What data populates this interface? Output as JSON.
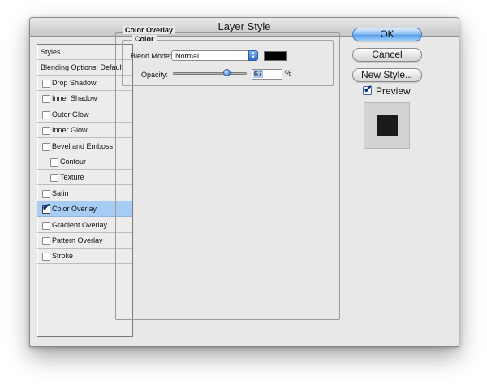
{
  "window": {
    "title": "Layer Style"
  },
  "styles_list": {
    "header": "Styles",
    "blending_options": "Blending Options: Default",
    "items": [
      {
        "label": "Drop Shadow",
        "checked": false,
        "indent": false,
        "selected": false
      },
      {
        "label": "Inner Shadow",
        "checked": false,
        "indent": false,
        "selected": false
      },
      {
        "label": "Outer Glow",
        "checked": false,
        "indent": false,
        "selected": false
      },
      {
        "label": "Inner Glow",
        "checked": false,
        "indent": false,
        "selected": false
      },
      {
        "label": "Bevel and Emboss",
        "checked": false,
        "indent": false,
        "selected": false
      },
      {
        "label": "Contour",
        "checked": false,
        "indent": true,
        "selected": false
      },
      {
        "label": "Texture",
        "checked": false,
        "indent": true,
        "selected": false
      },
      {
        "label": "Satin",
        "checked": false,
        "indent": false,
        "selected": false
      },
      {
        "label": "Color Overlay",
        "checked": true,
        "indent": false,
        "selected": true
      },
      {
        "label": "Gradient Overlay",
        "checked": false,
        "indent": false,
        "selected": false
      },
      {
        "label": "Pattern Overlay",
        "checked": false,
        "indent": false,
        "selected": false
      },
      {
        "label": "Stroke",
        "checked": false,
        "indent": false,
        "selected": false
      }
    ]
  },
  "color_overlay": {
    "group_title": "Color Overlay",
    "sub_title": "Color",
    "blend_mode_label": "Blend Mode:",
    "blend_mode_value": "Normal",
    "swatch_color": "#000000",
    "opacity_label": "Opacity:",
    "opacity_value": "67",
    "opacity_unit": "%",
    "opacity_fraction": 0.67
  },
  "buttons": {
    "ok": "OK",
    "cancel": "Cancel",
    "new_style": "New Style..."
  },
  "preview": {
    "label": "Preview",
    "checked": true,
    "swatch_color": "#1a1a1a"
  },
  "colors": {
    "selection": "#a8cdf5",
    "accent": "#5d9fe8"
  }
}
